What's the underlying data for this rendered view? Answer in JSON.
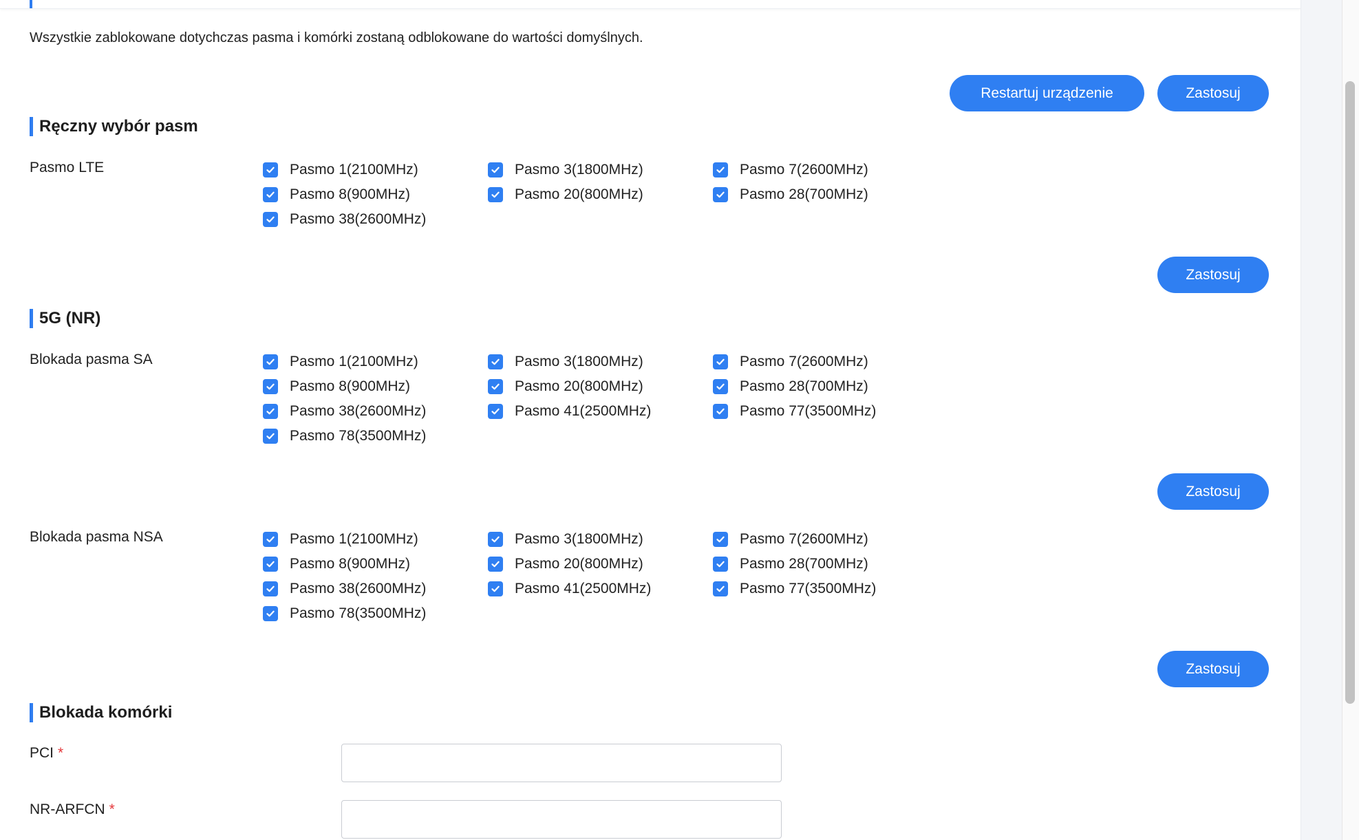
{
  "notice": "Wszystkie zablokowane dotychczas pasma i komórki zostaną odblokowane do wartości domyślnych.",
  "buttons": {
    "restart": "Restartuj urządzenie",
    "apply": "Zastosuj"
  },
  "colors": {
    "accent": "#2f7ff2",
    "required": "#e4393c"
  },
  "lte": {
    "title": "Ręczny wybór pasm",
    "label": "Pasmo LTE",
    "bands": [
      {
        "label": "Pasmo 1(2100MHz)",
        "checked": true
      },
      {
        "label": "Pasmo 3(1800MHz)",
        "checked": true
      },
      {
        "label": "Pasmo 7(2600MHz)",
        "checked": true
      },
      {
        "label": "Pasmo 8(900MHz)",
        "checked": true
      },
      {
        "label": "Pasmo 20(800MHz)",
        "checked": true
      },
      {
        "label": "Pasmo 28(700MHz)",
        "checked": true
      },
      {
        "label": "Pasmo 38(2600MHz)",
        "checked": true
      }
    ]
  },
  "nr": {
    "title": "5G (NR)",
    "sa": {
      "label": "Blokada pasma SA",
      "bands": [
        {
          "label": "Pasmo 1(2100MHz)",
          "checked": true
        },
        {
          "label": "Pasmo 3(1800MHz)",
          "checked": true
        },
        {
          "label": "Pasmo 7(2600MHz)",
          "checked": true
        },
        {
          "label": "Pasmo 8(900MHz)",
          "checked": true
        },
        {
          "label": "Pasmo 20(800MHz)",
          "checked": true
        },
        {
          "label": "Pasmo 28(700MHz)",
          "checked": true
        },
        {
          "label": "Pasmo 38(2600MHz)",
          "checked": true
        },
        {
          "label": "Pasmo 41(2500MHz)",
          "checked": true
        },
        {
          "label": "Pasmo 77(3500MHz)",
          "checked": true
        },
        {
          "label": "Pasmo 78(3500MHz)",
          "checked": true
        }
      ]
    },
    "nsa": {
      "label": "Blokada pasma NSA",
      "bands": [
        {
          "label": "Pasmo 1(2100MHz)",
          "checked": true
        },
        {
          "label": "Pasmo 3(1800MHz)",
          "checked": true
        },
        {
          "label": "Pasmo 7(2600MHz)",
          "checked": true
        },
        {
          "label": "Pasmo 8(900MHz)",
          "checked": true
        },
        {
          "label": "Pasmo 20(800MHz)",
          "checked": true
        },
        {
          "label": "Pasmo 28(700MHz)",
          "checked": true
        },
        {
          "label": "Pasmo 38(2600MHz)",
          "checked": true
        },
        {
          "label": "Pasmo 41(2500MHz)",
          "checked": true
        },
        {
          "label": "Pasmo 77(3500MHz)",
          "checked": true
        },
        {
          "label": "Pasmo 78(3500MHz)",
          "checked": true
        }
      ]
    }
  },
  "cell_lock": {
    "title": "Blokada komórki",
    "pci": {
      "label": "PCI",
      "required_mark": "*",
      "value": "",
      "placeholder": ""
    },
    "arfcn": {
      "label": "NR-ARFCN",
      "required_mark": "*",
      "value": "",
      "placeholder": ""
    }
  }
}
